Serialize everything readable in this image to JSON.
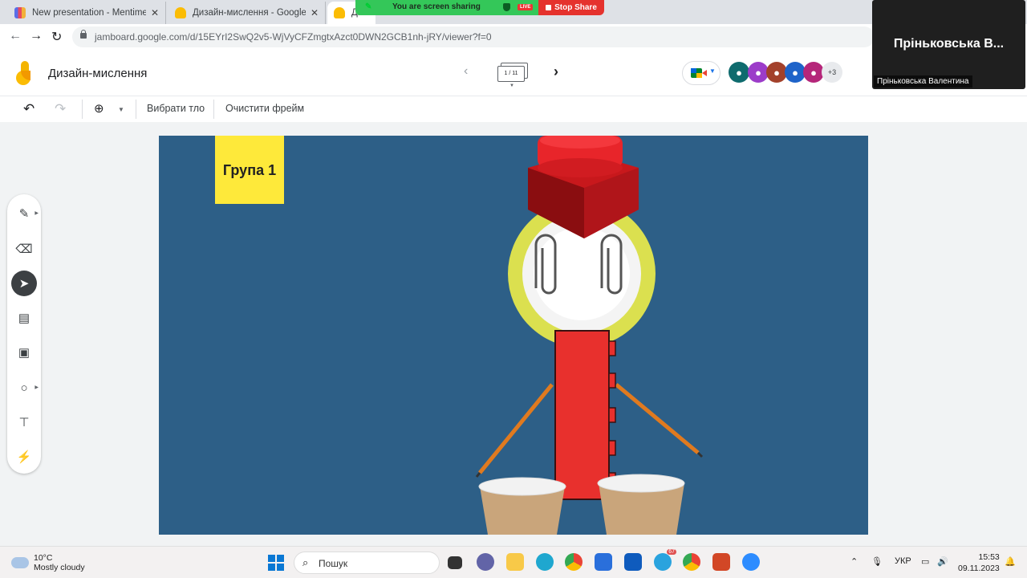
{
  "browser": {
    "tabs": [
      {
        "label": "New presentation - Mentimeter",
        "favicon_color": "#5a6ee8"
      },
      {
        "label": "Дизайн-мислення - Google Jam",
        "favicon_color": "#fbbc04"
      },
      {
        "label": "Ди",
        "favicon_color": "#fbbc04"
      }
    ],
    "url": "jamboard.google.com/d/15EYrI2SwQ2v5-WjVyCFZmgtxAzct0DWN2GCB1nh-jRY/viewer?f=0"
  },
  "screen_share": {
    "status": "You are screen sharing",
    "live_badge": "LIVE",
    "stop_label": "Stop Share"
  },
  "presenter": {
    "name_large": "Пріньковська В...",
    "name_full": "Пріньковська Валентина"
  },
  "app": {
    "title": "Дизайн-мислення",
    "frame_indicator": "1 / 11",
    "collaborators_more": "+3",
    "avatars": [
      {
        "icon": "rhino-icon",
        "color": "#0f6b6e"
      },
      {
        "icon": "lion-icon",
        "color": "#9c3cc9"
      },
      {
        "icon": "squirrel-icon",
        "color": "#a3412b"
      },
      {
        "icon": "fox-icon",
        "color": "#1e63c9"
      },
      {
        "icon": "cat-icon",
        "color": "#b5267a"
      }
    ]
  },
  "edit_toolbar": {
    "set_background": "Вибрати тло",
    "clear_frame": "Очистити фрейм"
  },
  "tools": [
    "pen-icon",
    "eraser-icon",
    "select-icon",
    "sticky-note-icon",
    "image-icon",
    "circle-icon",
    "text-box-icon",
    "laser-icon"
  ],
  "board": {
    "background": "#2d5f87",
    "sticky_note": {
      "text": "Група 1",
      "color": "#fee93a"
    }
  },
  "taskbar": {
    "weather_temp": "10°C",
    "weather_desc": "Mostly cloudy",
    "search_placeholder": "Пошук",
    "telegram_badge": "67",
    "language": "УКР",
    "time": "15:53",
    "date": "09.11.2023"
  }
}
